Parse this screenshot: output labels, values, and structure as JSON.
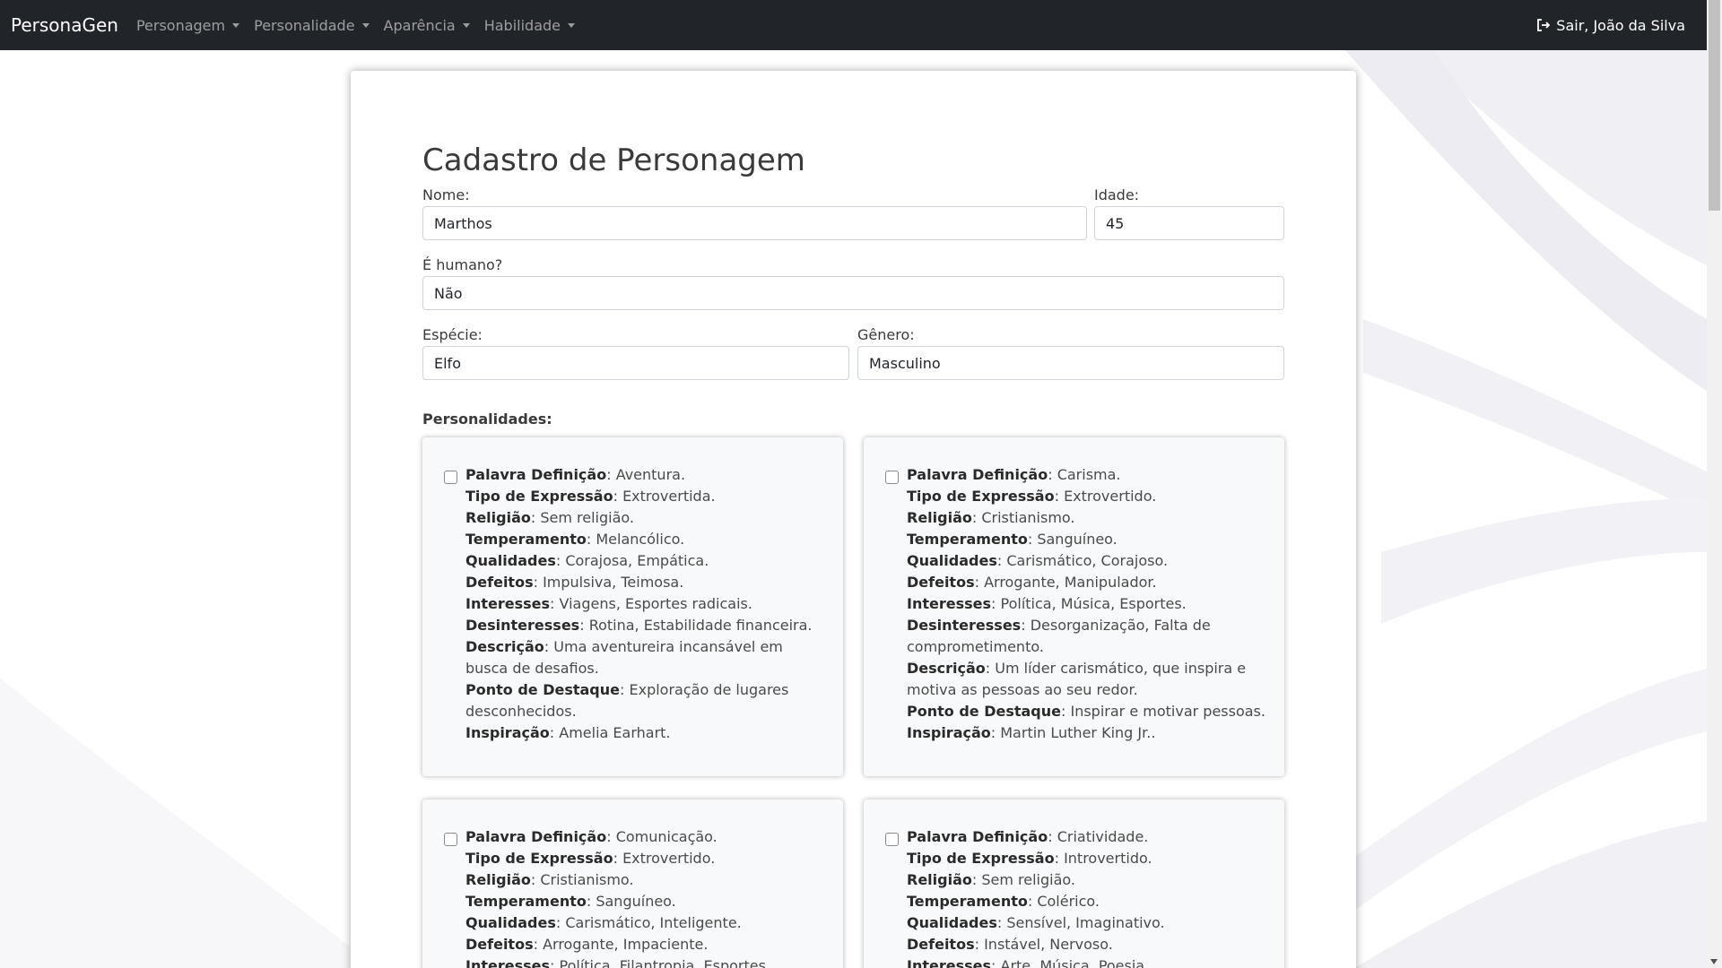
{
  "navbar": {
    "brand": "PersonaGen",
    "items": [
      {
        "label": "Personagem"
      },
      {
        "label": "Personalidade"
      },
      {
        "label": "Aparência"
      },
      {
        "label": "Habilidade"
      }
    ],
    "logout_label": "Sair, João da Silva"
  },
  "form": {
    "title": "Cadastro de Personagem",
    "nome_label": "Nome:",
    "nome_value": "Marthos",
    "idade_label": "Idade:",
    "idade_value": "45",
    "humano_label": "É humano?",
    "humano_value": "Não",
    "especie_label": "Espécie:",
    "especie_value": "Elfo",
    "genero_label": "Gênero:",
    "genero_value": "Masculino",
    "personalidades_label": "Personalidades:"
  },
  "field_names": {
    "palavra": "Palavra Definição",
    "tipo": "Tipo de Expressão",
    "religiao": "Religião",
    "temperamento": "Temperamento",
    "qualidades": "Qualidades",
    "defeitos": "Defeitos",
    "interesses": "Interesses",
    "desinteresses": "Desinteresses",
    "descricao": "Descrição",
    "destaque": "Ponto de Destaque",
    "inspiracao": "Inspiração"
  },
  "personalidades": [
    {
      "palavra": "Aventura.",
      "tipo": "Extrovertida.",
      "religiao": "Sem religião.",
      "temperamento": "Melancólico.",
      "qualidades": "Corajosa, Empática.",
      "defeitos": "Impulsiva, Teimosa.",
      "interesses": "Viagens, Esportes radicais.",
      "desinteresses": "Rotina, Estabilidade financeira.",
      "descricao": "Uma aventureira incansável em busca de desafios.",
      "destaque": "Exploração de lugares desconhecidos.",
      "inspiracao": "Amelia Earhart."
    },
    {
      "palavra": "Carisma.",
      "tipo": "Extrovertido.",
      "religiao": "Cristianismo.",
      "temperamento": "Sanguíneo.",
      "qualidades": "Carismático, Corajoso.",
      "defeitos": "Arrogante, Manipulador.",
      "interesses": "Política, Música, Esportes.",
      "desinteresses": "Desorganização, Falta de comprometimento.",
      "descricao": "Um líder carismático, que inspira e motiva as pessoas ao seu redor.",
      "destaque": "Inspirar e motivar pessoas.",
      "inspiracao": "Martin Luther King Jr.."
    },
    {
      "palavra": "Comunicação.",
      "tipo": "Extrovertido.",
      "religiao": "Cristianismo.",
      "temperamento": "Sanguíneo.",
      "qualidades": "Carismático, Inteligente.",
      "defeitos": "Arrogante, Impaciente.",
      "interesses": "Política, Filantropia, Esportes."
    },
    {
      "palavra": "Criatividade.",
      "tipo": "Introvertido.",
      "religiao": "Sem religião.",
      "temperamento": "Colérico.",
      "qualidades": "Sensível, Imaginativo.",
      "defeitos": "Instável, Nervoso.",
      "interesses": "Arte, Música, Poesia."
    }
  ]
}
